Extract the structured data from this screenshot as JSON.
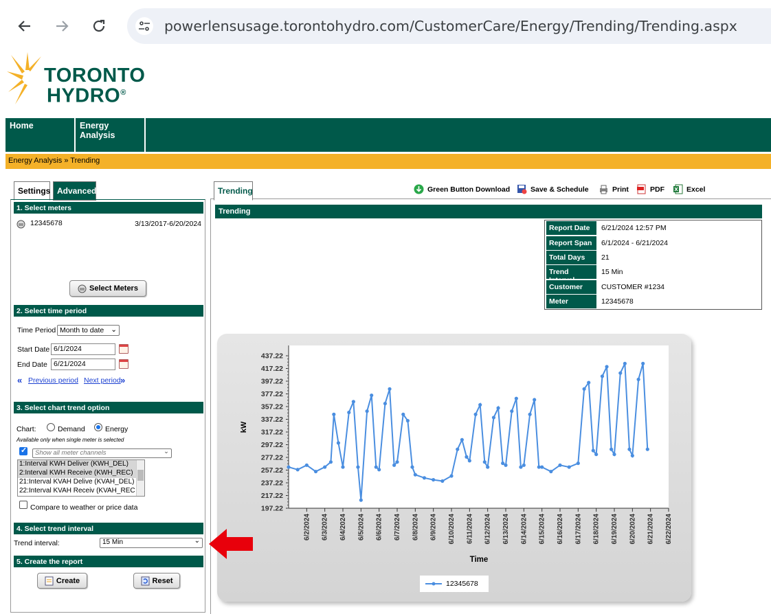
{
  "browser": {
    "url": "powerlensusage.torontohydro.com/CustomerCare/Energy/Trending/Trending.aspx",
    "icons": [
      "back-arrow-icon",
      "forward-arrow-icon",
      "reload-icon",
      "site-info-icon"
    ]
  },
  "logo": {
    "line1": "TORONTO",
    "line2": "HYDRO",
    "mark": "®"
  },
  "nav": {
    "home": "Home",
    "energy_analysis_1": "Energy",
    "energy_analysis_2": "Analysis"
  },
  "breadcrumb": "Energy Analysis » Trending",
  "left_tabs": {
    "settings": "Settings",
    "advanced": "Advanced"
  },
  "sections": {
    "meters": "1. Select meters",
    "time": "2. Select time period",
    "chart": "3. Select chart trend option",
    "interval": "4. Select trend interval",
    "create": "5. Create the report"
  },
  "meter": {
    "id": "12345678",
    "range": "3/13/2017-6/20/2024"
  },
  "select_meters_btn": "Select Meters",
  "time": {
    "period_label": "Time Period",
    "period_value": "Month to date",
    "start_label": "Start Date",
    "start_value": "6/1/2024",
    "end_label": "End Date",
    "end_value": "6/21/2024",
    "prev": "Previous period",
    "next": "Next period"
  },
  "chart_opts": {
    "label": "Chart:",
    "demand": "Demand",
    "energy": "Energy",
    "note": "Available only when single meter is selected",
    "channels_placeholder": "Show all meter channels",
    "channels": [
      "1:Interval KWH Deliver (KWH_DEL)",
      "2:Interval KWH Receive (KWH_REC)",
      "21:Interval KVAH Delive (KVAH_DEL)",
      "22:Interval KVAH Receiv (KVAH_REC"
    ],
    "compare": "Compare to weather or price data"
  },
  "interval": {
    "label": "Trend interval:",
    "value": "15 Min"
  },
  "buttons": {
    "create": "Create",
    "reset": "Reset"
  },
  "right_tab": "Trending",
  "toolbar": {
    "green_button": "Green Button Download",
    "save": "Save & Schedule",
    "print": "Print",
    "pdf": "PDF",
    "excel": "Excel"
  },
  "trend_title": "Trending",
  "report": [
    {
      "key": "Report Date",
      "value": "6/21/2024 12:57 PM"
    },
    {
      "key": "Report Span",
      "value": "6/1/2024 - 6/21/2024"
    },
    {
      "key": "Total Days",
      "value": "21"
    },
    {
      "key": "Trend Interval",
      "value": "15 Min"
    },
    {
      "key": "Customer",
      "value": "CUSTOMER #1234"
    },
    {
      "key": "Meter",
      "value": "12345678"
    }
  ],
  "colors": {
    "brand_green": "#00594a",
    "brand_orange": "#f4b128",
    "series": "#4a8ee0",
    "arrow": "#e8000b"
  },
  "chart_data": {
    "type": "line",
    "title": "",
    "xlabel": "Time",
    "ylabel": "kW",
    "ylim": [
      197.22,
      437.22
    ],
    "yticks": [
      "437.22",
      "417.22",
      "397.22",
      "377.22",
      "357.22",
      "337.22",
      "317.22",
      "297.22",
      "277.22",
      "257.22",
      "237.22",
      "217.22",
      "197.22"
    ],
    "xticks": [
      "6/2/2024",
      "6/3/2024",
      "6/4/2024",
      "6/5/2024",
      "6/6/2024",
      "6/7/2024",
      "6/8/2024",
      "6/9/2024",
      "6/10/2024",
      "6/11/2024",
      "6/12/2024",
      "6/13/2024",
      "6/14/2024",
      "6/15/2024",
      "6/16/2024",
      "6/17/2024",
      "6/18/2024",
      "6/19/2024",
      "6/20/2024",
      "6/21/2024",
      "6/22/2024"
    ],
    "xlim": [
      "6/1/2024",
      "6/22/2024"
    ],
    "series": [
      {
        "name": "12345678",
        "x": [
          "6/1/2024 00:00",
          "6/1/2024 12:00",
          "6/2/2024 00:00",
          "6/2/2024 12:00",
          "6/3/2024 00:00",
          "6/3/2024 08:00",
          "6/3/2024 12:00",
          "6/3/2024 18:00",
          "6/4/2024 00:00",
          "6/4/2024 08:00",
          "6/4/2024 14:00",
          "6/4/2024 20:00",
          "6/5/2024 00:00",
          "6/5/2024 08:00",
          "6/5/2024 14:00",
          "6/5/2024 20:00",
          "6/6/2024 00:00",
          "6/6/2024 08:00",
          "6/6/2024 14:00",
          "6/6/2024 20:00",
          "6/7/2024 00:00",
          "6/7/2024 08:00",
          "6/7/2024 14:00",
          "6/7/2024 20:00",
          "6/8/2024 00:00",
          "6/8/2024 12:00",
          "6/9/2024 00:00",
          "6/9/2024 12:00",
          "6/10/2024 00:00",
          "6/10/2024 08:00",
          "6/10/2024 14:00",
          "6/10/2024 20:00",
          "6/11/2024 00:00",
          "6/11/2024 08:00",
          "6/11/2024 14:00",
          "6/11/2024 20:00",
          "6/12/2024 00:00",
          "6/12/2024 08:00",
          "6/12/2024 14:00",
          "6/12/2024 20:00",
          "6/13/2024 00:00",
          "6/13/2024 08:00",
          "6/13/2024 14:00",
          "6/13/2024 20:00",
          "6/14/2024 00:00",
          "6/14/2024 08:00",
          "6/14/2024 14:00",
          "6/14/2024 20:00",
          "6/15/2024 00:00",
          "6/15/2024 12:00",
          "6/16/2024 00:00",
          "6/16/2024 12:00",
          "6/17/2024 00:00",
          "6/17/2024 08:00",
          "6/17/2024 14:00",
          "6/17/2024 20:00",
          "6/18/2024 00:00",
          "6/18/2024 08:00",
          "6/18/2024 14:00",
          "6/18/2024 20:00",
          "6/19/2024 00:00",
          "6/19/2024 08:00",
          "6/19/2024 14:00",
          "6/19/2024 20:00",
          "6/20/2024 00:00",
          "6/20/2024 08:00",
          "6/20/2024 14:00",
          "6/20/2024 20:00"
        ],
        "y": [
          262,
          258,
          265,
          255,
          262,
          270,
          345,
          300,
          262,
          348,
          365,
          262,
          210,
          350,
          375,
          262,
          258,
          362,
          385,
          265,
          270,
          345,
          335,
          262,
          250,
          245,
          242,
          240,
          248,
          290,
          305,
          278,
          272,
          345,
          360,
          270,
          262,
          340,
          355,
          268,
          265,
          350,
          370,
          262,
          265,
          345,
          368,
          262,
          262,
          255,
          265,
          262,
          268,
          385,
          395,
          288,
          282,
          405,
          420,
          290,
          282,
          410,
          425,
          290,
          280,
          400,
          425,
          290
        ]
      }
    ]
  }
}
